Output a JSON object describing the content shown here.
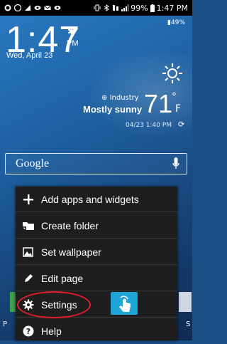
{
  "status_bar": {
    "battery_percent": "99%",
    "time": "1:47 PM",
    "notification_icons": [
      "whatsapp-icon",
      "badge-99-icon",
      "signal-icon",
      "eye-icon",
      "mail-icon",
      "eye-icon",
      "vibrate-icon",
      "bluetooth-icon",
      "data-icon",
      "signal-bars-icon"
    ]
  },
  "clock_widget": {
    "time": "1:47",
    "ampm": "PM",
    "date": "Wed, April 23",
    "battery": "49%"
  },
  "weather_widget": {
    "location": "Industry",
    "condition": "Mostly sunny",
    "temperature": "71",
    "degree": "°",
    "unit": "F",
    "updated": "04/23 1:40 PM"
  },
  "search_bar": {
    "label": "Google"
  },
  "dock": {
    "left_label": "P",
    "right_label": "S"
  },
  "menu": {
    "items": [
      {
        "label": "Add apps and widgets",
        "icon": "plus-icon"
      },
      {
        "label": "Create folder",
        "icon": "folder-icon"
      },
      {
        "label": "Set wallpaper",
        "icon": "wallpaper-icon"
      },
      {
        "label": "Edit page",
        "icon": "pencil-icon"
      },
      {
        "label": "Settings",
        "icon": "gear-icon"
      },
      {
        "label": "Help",
        "icon": "help-icon"
      }
    ]
  },
  "colors": {
    "menu_bg": "#1e1e1e",
    "highlight_oval": "#e0202a",
    "hint_tile": "#1ea4d6"
  }
}
